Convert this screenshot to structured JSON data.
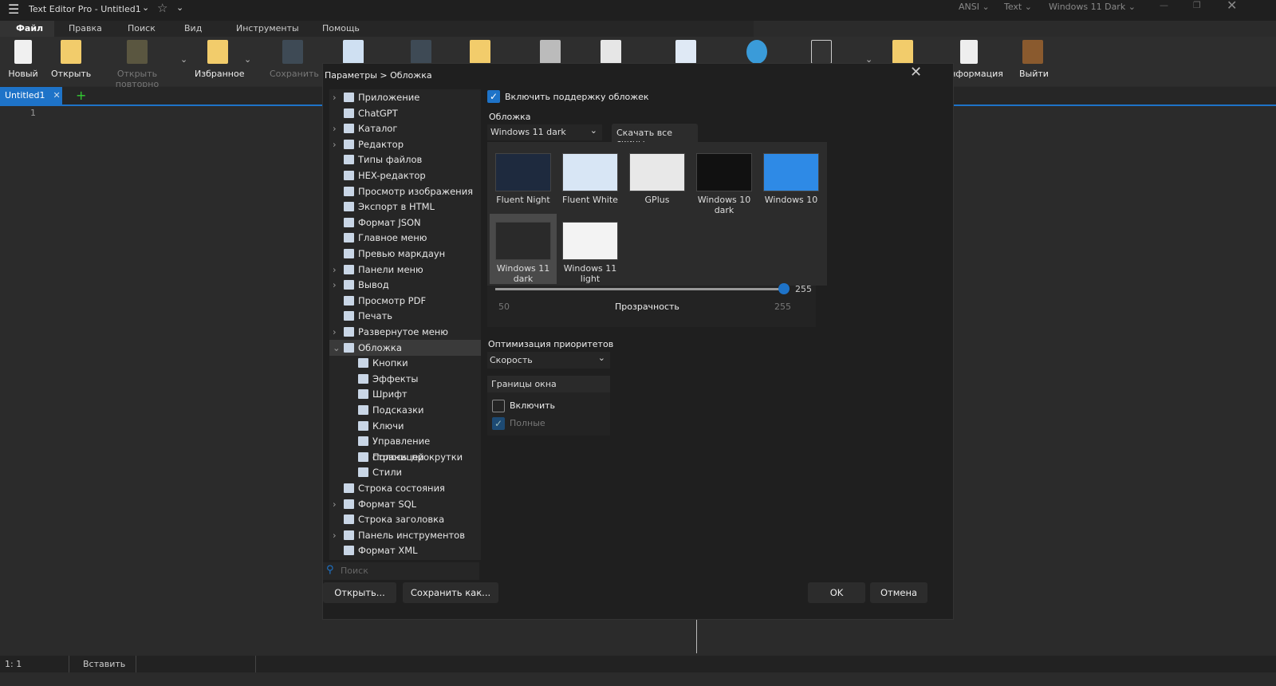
{
  "titlebar": {
    "app": "Text Editor Pro  -  Untitled1",
    "encoding": "ANSI",
    "mode": "Text",
    "theme": "Windows 11 Dark"
  },
  "menu": [
    "Файл",
    "Правка",
    "Поиск",
    "Вид",
    "Инструменты",
    "Помощь"
  ],
  "toolbar": {
    "new": "Новый",
    "open": "Открыть",
    "reopen": "Открыть повторно",
    "favorites": "Избранное",
    "save": "Сохранить",
    "info": "Информация",
    "exit": "Выйти"
  },
  "tab": {
    "name": "Untitled1"
  },
  "editor": {
    "line": "1"
  },
  "status": {
    "pos": "1: 1",
    "insert": "Вставить"
  },
  "dialog": {
    "breadcrumb": "Параметры  >  Обложка",
    "tree": [
      {
        "label": "Приложение",
        "exp": true
      },
      {
        "label": "ChatGPT"
      },
      {
        "label": "Каталог",
        "exp": true
      },
      {
        "label": "Редактор",
        "exp": true
      },
      {
        "label": "Типы файлов"
      },
      {
        "label": "HEX-редактор"
      },
      {
        "label": "Просмотр изображения"
      },
      {
        "label": "Экспорт в HTML"
      },
      {
        "label": "Формат JSON"
      },
      {
        "label": "Главное меню"
      },
      {
        "label": "Превью маркдаун"
      },
      {
        "label": "Панели меню",
        "exp": true
      },
      {
        "label": "Вывод",
        "exp": true
      },
      {
        "label": "Просмотр PDF"
      },
      {
        "label": "Печать"
      },
      {
        "label": "Развернутое меню",
        "exp": true
      },
      {
        "label": "Обложка",
        "open": true,
        "sel": true
      },
      {
        "label": "Кнопки",
        "sub": true
      },
      {
        "label": "Эффекты",
        "sub": true
      },
      {
        "label": "Шрифт",
        "sub": true
      },
      {
        "label": "Подсказки",
        "sub": true
      },
      {
        "label": "Ключи",
        "sub": true
      },
      {
        "label": "Управление страницей",
        "sub": true
      },
      {
        "label": "Полосы прокрутки",
        "sub": true
      },
      {
        "label": "Стили",
        "sub": true
      },
      {
        "label": "Строка состояния"
      },
      {
        "label": "Формат SQL",
        "exp": true
      },
      {
        "label": "Строка заголовка"
      },
      {
        "label": "Панель инструментов",
        "exp": true
      },
      {
        "label": "Формат XML"
      }
    ],
    "search_placeholder": "Поиск",
    "open_btn": "Открыть...",
    "saveas_btn": "Сохранить как...",
    "ok": "OK",
    "cancel": "Отмена",
    "enable_skins": "Включить поддержку обложек",
    "skin_label": "Обложка",
    "skin_value": "Windows 11 dark",
    "download": "Скачать все скины",
    "skins": [
      "Fluent Night",
      "Fluent White",
      "GPlus",
      "Windows 10 dark",
      "Windows 10",
      "Windows 11 dark",
      "Windows 11 light"
    ],
    "transparency": {
      "label": "Прозрачность",
      "min": "50",
      "max": "255",
      "value": "255"
    },
    "priority_label": "Оптимизация приоритетов",
    "priority_value": "Скорость",
    "borders_label": "Границы окна",
    "borders_enable": "Включить",
    "borders_full": "Полные"
  }
}
